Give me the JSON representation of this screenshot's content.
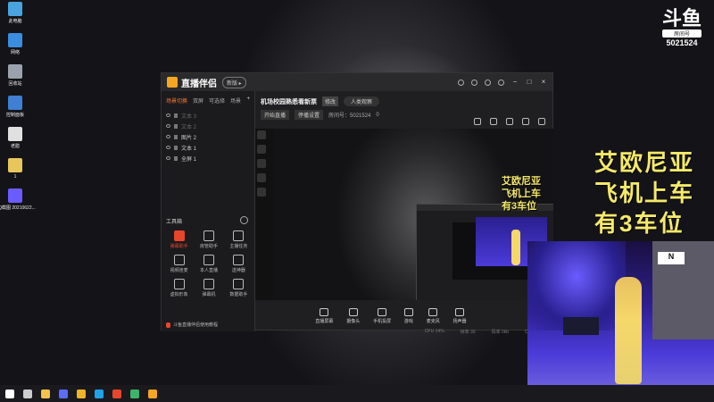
{
  "desktop": {
    "icons": [
      {
        "label": "此电脑",
        "icon": "computer-icon",
        "color": "#4aa3df"
      },
      {
        "label": "网络",
        "icon": "network-icon",
        "color": "#3b8de0"
      },
      {
        "label": "回收站",
        "icon": "recycle-bin-icon",
        "color": "#9aa3ad"
      },
      {
        "label": "控制面板",
        "icon": "control-panel-icon",
        "color": "#3f7fd4"
      },
      {
        "label": "老腊",
        "icon": "file-icon",
        "color": "#e0e0e0"
      },
      {
        "label": "1",
        "icon": "file-icon",
        "color": "#e8c75a"
      },
      {
        "label": "QQ截图 20210622...",
        "icon": "image-file-icon",
        "color": "#6a5cff"
      }
    ]
  },
  "douyu": {
    "mark": "斗鱼",
    "room_label": "房间号",
    "room_number": "5021524"
  },
  "app": {
    "name": "直播伴侣",
    "badge": "新版 ▸",
    "scene_tabs": [
      "场景切换",
      "双屏",
      "可选择",
      "场景"
    ],
    "sources": [
      {
        "label": "文本 3",
        "dim": true
      },
      {
        "label": "文本 2",
        "dim": true
      },
      {
        "label": "图片 2",
        "dim": false
      },
      {
        "label": "文本 1",
        "dim": false
      },
      {
        "label": "全屏 1",
        "dim": false
      }
    ],
    "tools_header": "工具箱",
    "tools": [
      {
        "label": "弹幕助手",
        "highlight": true
      },
      {
        "label": "房管助手",
        "highlight": false
      },
      {
        "label": "主播任务",
        "highlight": false
      },
      {
        "label": "视频连麦",
        "highlight": false
      },
      {
        "label": "本人直播",
        "highlight": false
      },
      {
        "label": "送神器",
        "highlight": false
      },
      {
        "label": "虚拟形象",
        "highlight": false
      },
      {
        "label": "弹幕机",
        "highlight": false
      },
      {
        "label": "数据助手",
        "highlight": false
      }
    ],
    "bottom_tip": "斗鱼直播伴侣使用教程",
    "room_title": "机场校园熟悉看新票",
    "room_tag": "修改",
    "room_category": "人类观察",
    "room_row2_chips": [
      "开始直播",
      "停播设置"
    ],
    "room_row2_id": "房间号：5021524",
    "room_row2_fans": "0",
    "bottom_actions": [
      "直播屏幕",
      "摄像头",
      "手机投屏",
      "游戏",
      "麦克风",
      "扬声器"
    ],
    "status": [
      "CPU 14%",
      "帧率 30",
      "码率 0kb",
      "CPU 占用"
    ]
  },
  "overlay": {
    "lines": [
      "艾欧尼亚",
      "飞机上车",
      "有3车位"
    ],
    "small_lines": [
      "艾欧尼亚",
      "飞机上车",
      "有3车位"
    ]
  },
  "camera": {
    "sign_text": "N"
  },
  "taskbar": {
    "items": [
      {
        "icon": "windows-start-icon",
        "color": "#ffffff"
      },
      {
        "icon": "task-view-icon",
        "color": "#cccccc"
      },
      {
        "icon": "file-explorer-icon",
        "color": "#f2c14e"
      },
      {
        "icon": "app-icon",
        "color": "#5b6cff"
      },
      {
        "icon": "game-icon",
        "color": "#f0b429"
      },
      {
        "icon": "edge-icon",
        "color": "#1fa3e8"
      },
      {
        "icon": "weibo-icon",
        "color": "#e8452d"
      },
      {
        "icon": "chrome-icon",
        "color": "#3fb36b"
      },
      {
        "icon": "stream-companion-icon",
        "color": "#f5a623"
      }
    ]
  }
}
